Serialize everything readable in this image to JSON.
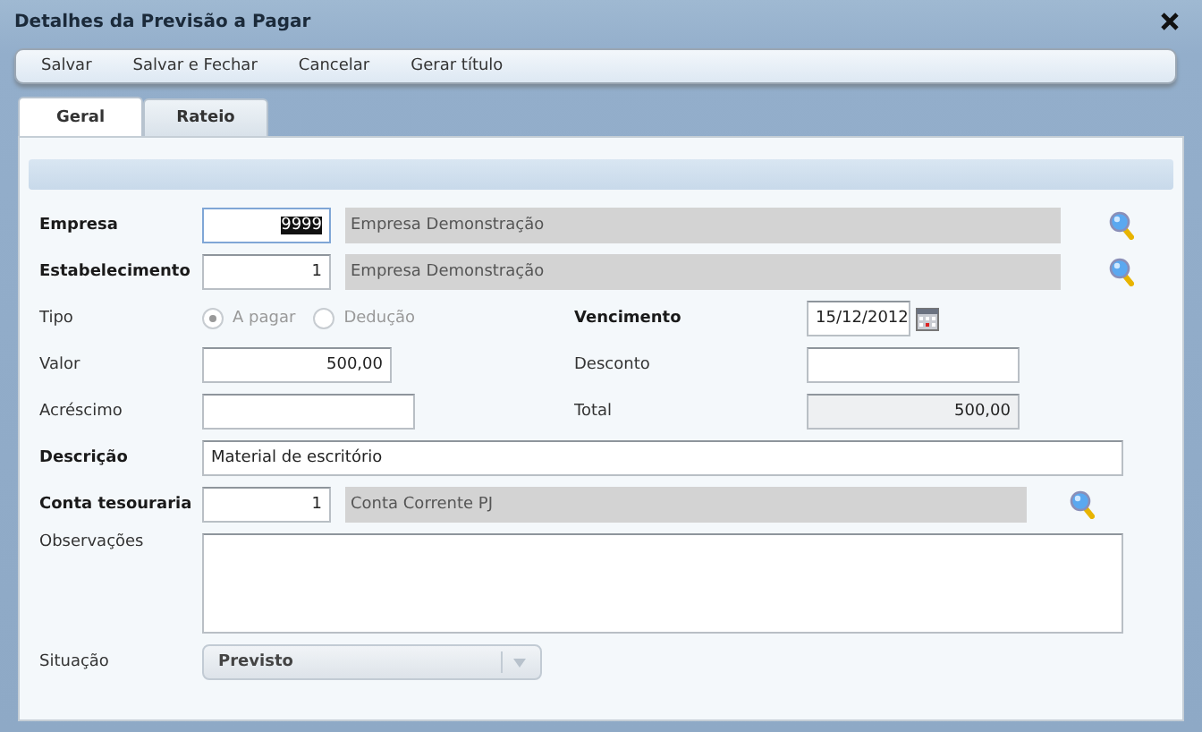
{
  "window": {
    "title": "Detalhes da Previsão a Pagar"
  },
  "toolbar": [
    "Salvar",
    "Salvar e Fechar",
    "Cancelar",
    "Gerar título"
  ],
  "tabs": [
    {
      "label": "Geral",
      "selected": true
    },
    {
      "label": "Rateio",
      "selected": false
    }
  ],
  "form": {
    "empresa": {
      "label": "Empresa",
      "required": true,
      "code": "9999",
      "code_selected": true,
      "name": "Empresa Demonstração"
    },
    "estabelecimento": {
      "label": "Estabelecimento",
      "required": true,
      "code": "1",
      "code_selected": false,
      "name": "Empresa Demonstração"
    },
    "tipo": {
      "label": "Tipo",
      "required": false,
      "disabled": true,
      "options": [
        {
          "label": "A pagar",
          "selected": true
        },
        {
          "label": "Dedução",
          "selected": false
        }
      ]
    },
    "vencimento": {
      "label": "Vencimento",
      "required": true,
      "value": "15/12/2012"
    },
    "valor": {
      "label": "Valor",
      "required": false,
      "value": "500,00"
    },
    "desconto": {
      "label": "Desconto",
      "required": false
    },
    "acrescimo": {
      "label": "Acréscimo",
      "required": false
    },
    "total": {
      "label": "Total",
      "required": false,
      "value": "500,00",
      "readonly": true
    },
    "descricao": {
      "label": "Descrição",
      "required": true,
      "value": "Material de escritório"
    },
    "conta": {
      "label": "Conta tesouraria",
      "required": true,
      "code": "1",
      "code_selected": false,
      "name": "Conta Corrente PJ"
    },
    "observacoes": {
      "label": "Observações",
      "required": false
    },
    "situacao": {
      "label": "Situação",
      "required": false,
      "value": "Previsto"
    }
  }
}
